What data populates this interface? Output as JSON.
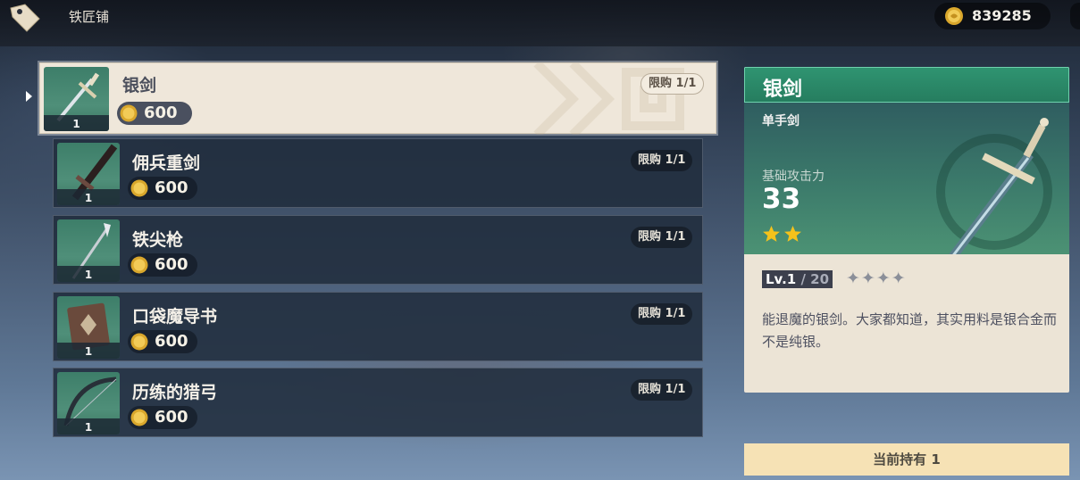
{
  "header": {
    "shop_title": "铁匠铺",
    "mora_amount": "839285"
  },
  "items": [
    {
      "name": "银剑",
      "price": "600",
      "limit": "限购 1/1",
      "count": "1",
      "icon": "silver-sword-icon",
      "selected": true
    },
    {
      "name": "佣兵重剑",
      "price": "600",
      "limit": "限购 1/1",
      "count": "1",
      "icon": "claymore-icon",
      "selected": false
    },
    {
      "name": "铁尖枪",
      "price": "600",
      "limit": "限购 1/1",
      "count": "1",
      "icon": "spear-icon",
      "selected": false
    },
    {
      "name": "口袋魔导书",
      "price": "600",
      "limit": "限购 1/1",
      "count": "1",
      "icon": "catalyst-book-icon",
      "selected": false
    },
    {
      "name": "历练的猎弓",
      "price": "600",
      "limit": "限购 1/1",
      "count": "1",
      "icon": "bow-icon",
      "selected": false
    }
  ],
  "detail": {
    "title": "银剑",
    "type": "单手剑",
    "stat_label": "基础攻击力",
    "stat_value": "33",
    "rarity": 2,
    "level": "Lv.1",
    "level_max": " / 20",
    "refine_stars": "✦✦✦✦",
    "description": "能退魔的银剑。大家都知道，其实用料是银合金而不是纯银。"
  },
  "owned": {
    "text": "当前持有 1"
  },
  "colors": {
    "header_green": "#2f9471",
    "selected_bg": "#efe7da",
    "owned_bar": "#f6e2b5",
    "star": "#f5c21b"
  }
}
